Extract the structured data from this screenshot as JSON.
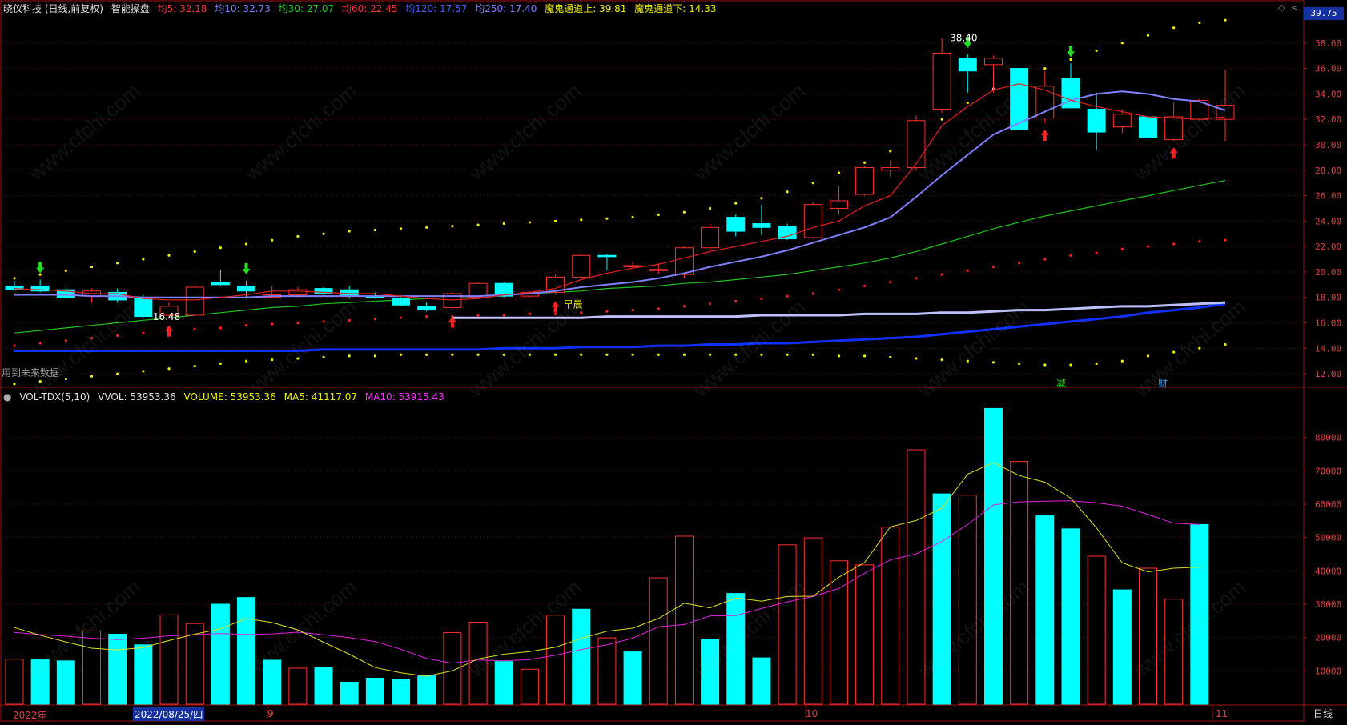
{
  "header": {
    "stock_title": "晓仪科技 (日线,前复权)",
    "indicator_name": "智能操盘",
    "ma5": "均5: 32.18",
    "ma10": "均10: 32.73",
    "ma30": "均30: 27.07",
    "ma60": "均60: 22.45",
    "ma120": "均120: 17.57",
    "ma250": "均250: 17.40",
    "channel_up": "魔鬼通道上: 39.81",
    "channel_down": "魔鬼通道下: 14.33",
    "price_badge": "39.75"
  },
  "volume_header": {
    "name": "VOL-TDX(5,10)",
    "vvol": "VVOL: 53953.36",
    "volume": "VOLUME: 53953.36",
    "ma5": "MA5: 41117.07",
    "ma10": "MA10: 53915.43"
  },
  "footer": {
    "year_label": "2022年",
    "cursor_date": "2022/08/25/四",
    "month_9": "9",
    "month_10": "10",
    "month_11": "11",
    "period_button": "日线"
  },
  "notes": {
    "future_data": "用到未来数据",
    "morning_star": "早晨",
    "high_label": "38.40",
    "low_label": "16.48",
    "flag_reduce": "减",
    "flag_finance": "财"
  },
  "watermark": "www.cfchi.com",
  "colors": {
    "up": "#ff3030",
    "down": "#00ffff",
    "ma5": "#e02020",
    "ma10": "#8080ff",
    "ma30": "#20c020",
    "ma120": "#c0c0ff",
    "ma250": "#1030ff",
    "vol_ma5": "#e0e020",
    "vol_ma10": "#e020e0",
    "axis": "#a01010"
  },
  "chart_data": [
    {
      "type": "candlestick",
      "title": "晓仪科技 (日线,前复权)",
      "ylim": [
        11,
        40
      ],
      "yticks": [
        "12.00",
        "14.00",
        "16.00",
        "18.00",
        "20.00",
        "22.00",
        "24.00",
        "26.00",
        "28.00",
        "30.00",
        "32.00",
        "34.00",
        "36.00",
        "38.00"
      ],
      "candles": [
        {
          "o": 18.9,
          "h": 19.3,
          "l": 18.5,
          "c": 18.6
        },
        {
          "o": 18.9,
          "h": 19.4,
          "l": 18.4,
          "c": 18.5
        },
        {
          "o": 18.6,
          "h": 18.8,
          "l": 17.9,
          "c": 18.0
        },
        {
          "o": 18.1,
          "h": 18.7,
          "l": 17.6,
          "c": 18.5
        },
        {
          "o": 18.4,
          "h": 18.7,
          "l": 17.6,
          "c": 17.8
        },
        {
          "o": 18.0,
          "h": 18.2,
          "l": 16.4,
          "c": 16.5
        },
        {
          "o": 16.6,
          "h": 17.6,
          "l": 16.3,
          "c": 17.3
        },
        {
          "o": 16.6,
          "h": 19.0,
          "l": 16.6,
          "c": 18.8
        },
        {
          "o": 19.2,
          "h": 20.2,
          "l": 18.9,
          "c": 19.0
        },
        {
          "o": 18.9,
          "h": 19.3,
          "l": 17.9,
          "c": 18.5
        },
        {
          "o": 18.0,
          "h": 18.9,
          "l": 17.9,
          "c": 18.2
        },
        {
          "o": 18.2,
          "h": 18.8,
          "l": 18.0,
          "c": 18.6
        },
        {
          "o": 18.7,
          "h": 18.8,
          "l": 18.1,
          "c": 18.3
        },
        {
          "o": 18.6,
          "h": 18.9,
          "l": 17.9,
          "c": 18.1
        },
        {
          "o": 18.1,
          "h": 18.4,
          "l": 17.9,
          "c": 18.0
        },
        {
          "o": 17.9,
          "h": 18.0,
          "l": 17.3,
          "c": 17.4
        },
        {
          "o": 17.3,
          "h": 17.6,
          "l": 16.9,
          "c": 17.0
        },
        {
          "o": 17.2,
          "h": 18.4,
          "l": 17.0,
          "c": 18.3
        },
        {
          "o": 18.0,
          "h": 19.2,
          "l": 17.9,
          "c": 19.1
        },
        {
          "o": 19.1,
          "h": 19.2,
          "l": 18.0,
          "c": 18.1
        },
        {
          "o": 18.1,
          "h": 18.5,
          "l": 18.0,
          "c": 18.4
        },
        {
          "o": 18.4,
          "h": 19.8,
          "l": 18.2,
          "c": 19.6
        },
        {
          "o": 19.6,
          "h": 21.5,
          "l": 19.5,
          "c": 21.3
        },
        {
          "o": 21.3,
          "h": 21.4,
          "l": 20.1,
          "c": 21.2
        },
        {
          "o": 20.4,
          "h": 20.8,
          "l": 20.3,
          "c": 20.5
        },
        {
          "o": 20.2,
          "h": 20.7,
          "l": 19.8,
          "c": 20.2
        },
        {
          "o": 19.8,
          "h": 22.0,
          "l": 19.5,
          "c": 21.9
        },
        {
          "o": 21.9,
          "h": 23.8,
          "l": 21.6,
          "c": 23.5
        },
        {
          "o": 24.3,
          "h": 24.5,
          "l": 22.8,
          "c": 23.2
        },
        {
          "o": 23.8,
          "h": 25.3,
          "l": 22.9,
          "c": 23.5
        },
        {
          "o": 23.6,
          "h": 23.8,
          "l": 22.5,
          "c": 22.6
        },
        {
          "o": 22.7,
          "h": 25.5,
          "l": 22.6,
          "c": 25.3
        },
        {
          "o": 25.0,
          "h": 26.8,
          "l": 24.5,
          "c": 25.6
        },
        {
          "o": 26.1,
          "h": 28.3,
          "l": 26.0,
          "c": 28.2
        },
        {
          "o": 28.0,
          "h": 28.8,
          "l": 27.5,
          "c": 28.2
        },
        {
          "o": 28.2,
          "h": 32.3,
          "l": 28.0,
          "c": 31.9
        },
        {
          "o": 32.8,
          "h": 38.4,
          "l": 32.5,
          "c": 37.2
        },
        {
          "o": 36.8,
          "h": 37.1,
          "l": 34.1,
          "c": 35.8
        },
        {
          "o": 36.3,
          "h": 37.0,
          "l": 34.1,
          "c": 36.8
        },
        {
          "o": 36.0,
          "h": 36.0,
          "l": 31.2,
          "c": 31.2
        },
        {
          "o": 32.1,
          "h": 35.8,
          "l": 31.7,
          "c": 34.6
        },
        {
          "o": 35.2,
          "h": 36.4,
          "l": 32.9,
          "c": 32.9
        },
        {
          "o": 32.8,
          "h": 34.1,
          "l": 29.6,
          "c": 31.0
        },
        {
          "o": 31.4,
          "h": 32.8,
          "l": 30.9,
          "c": 32.4
        },
        {
          "o": 32.2,
          "h": 32.6,
          "l": 30.4,
          "c": 30.6
        },
        {
          "o": 30.4,
          "h": 33.3,
          "l": 30.3,
          "c": 32.2
        },
        {
          "o": 32.0,
          "h": 33.6,
          "l": 31.9,
          "c": 33.5
        },
        {
          "o": 32.0,
          "h": 35.9,
          "l": 30.3,
          "c": 33.1
        }
      ],
      "ma5": [
        18.7,
        18.6,
        18.5,
        18.3,
        18.3,
        17.9,
        17.8,
        17.8,
        18.0,
        18.2,
        18.5,
        18.5,
        18.4,
        18.3,
        18.3,
        18.1,
        17.9,
        17.8,
        17.9,
        18.2,
        18.4,
        18.7,
        19.4,
        19.9,
        20.3,
        20.6,
        21.1,
        21.6,
        22.0,
        22.4,
        22.8,
        23.5,
        24.0,
        25.2,
        26.0,
        28.5,
        31.5,
        33.0,
        34.3,
        34.8,
        34.3,
        33.5,
        33.0,
        32.6,
        32.2,
        32.1,
        32.0,
        32.2
      ],
      "ma10": [
        18.2,
        18.2,
        18.2,
        18.1,
        18.1,
        18.0,
        18.0,
        18.0,
        18.0,
        18.0,
        18.1,
        18.1,
        18.1,
        18.1,
        18.1,
        18.1,
        18.1,
        18.1,
        18.1,
        18.2,
        18.3,
        18.5,
        18.8,
        19.0,
        19.2,
        19.5,
        19.9,
        20.4,
        20.8,
        21.2,
        21.7,
        22.3,
        22.9,
        23.5,
        24.3,
        25.9,
        27.6,
        29.2,
        30.8,
        31.7,
        32.6,
        33.5,
        34.0,
        34.2,
        34.0,
        33.6,
        33.4,
        32.7
      ],
      "ma30": [
        15.2,
        15.4,
        15.6,
        15.8,
        16.0,
        16.2,
        16.4,
        16.6,
        16.8,
        17.0,
        17.2,
        17.3,
        17.5,
        17.6,
        17.7,
        17.8,
        17.9,
        18.0,
        18.1,
        18.2,
        18.3,
        18.4,
        18.5,
        18.7,
        18.8,
        18.9,
        19.1,
        19.2,
        19.4,
        19.6,
        19.8,
        20.1,
        20.4,
        20.7,
        21.1,
        21.6,
        22.2,
        22.8,
        23.4,
        23.9,
        24.4,
        24.8,
        25.2,
        25.6,
        26.0,
        26.4,
        26.8,
        27.2
      ],
      "ma120": [
        null,
        null,
        null,
        null,
        null,
        null,
        null,
        null,
        null,
        null,
        null,
        null,
        null,
        null,
        null,
        null,
        null,
        16.4,
        16.4,
        16.4,
        16.4,
        16.4,
        16.4,
        16.5,
        16.5,
        16.5,
        16.5,
        16.5,
        16.5,
        16.6,
        16.6,
        16.6,
        16.6,
        16.7,
        16.7,
        16.7,
        16.8,
        16.8,
        16.9,
        17.0,
        17.0,
        17.1,
        17.2,
        17.3,
        17.3,
        17.4,
        17.5,
        17.6
      ],
      "ma250": [
        13.8,
        13.8,
        13.8,
        13.8,
        13.8,
        13.8,
        13.8,
        13.8,
        13.8,
        13.8,
        13.8,
        13.8,
        13.9,
        13.9,
        13.9,
        13.9,
        13.9,
        13.9,
        13.9,
        14.0,
        14.0,
        14.0,
        14.1,
        14.1,
        14.1,
        14.2,
        14.2,
        14.3,
        14.3,
        14.4,
        14.4,
        14.5,
        14.6,
        14.7,
        14.8,
        14.9,
        15.1,
        15.3,
        15.5,
        15.7,
        15.9,
        16.1,
        16.3,
        16.5,
        16.8,
        17.0,
        17.2,
        17.5
      ],
      "upper_channel": [
        19.5,
        19.8,
        20.1,
        20.4,
        20.7,
        21.0,
        21.3,
        21.6,
        21.9,
        22.2,
        22.5,
        22.8,
        23.0,
        23.2,
        23.3,
        23.4,
        23.5,
        23.6,
        23.7,
        23.8,
        23.9,
        24.0,
        24.1,
        24.2,
        24.3,
        24.5,
        24.7,
        25.0,
        25.4,
        25.8,
        26.3,
        27.0,
        27.8,
        28.6,
        29.5,
        30.7,
        32.0,
        33.3,
        34.4,
        35.2,
        36.0,
        36.7,
        37.4,
        38.0,
        38.6,
        39.2,
        39.6,
        39.8
      ],
      "lower_channel": [
        11.2,
        11.4,
        11.6,
        11.8,
        12.0,
        12.2,
        12.4,
        12.6,
        12.8,
        13.0,
        13.1,
        13.2,
        13.3,
        13.4,
        13.4,
        13.5,
        13.5,
        13.5,
        13.5,
        13.5,
        13.5,
        13.5,
        13.5,
        13.5,
        13.5,
        13.5,
        13.5,
        13.5,
        13.5,
        13.5,
        13.5,
        13.5,
        13.4,
        13.4,
        13.3,
        13.2,
        13.1,
        13.0,
        12.9,
        12.8,
        12.7,
        12.7,
        12.8,
        13.0,
        13.4,
        13.7,
        14.0,
        14.3
      ],
      "mid_dots": [
        14.2,
        14.4,
        14.6,
        14.8,
        15.0,
        15.2,
        15.3,
        15.5,
        15.6,
        15.8,
        15.9,
        16.0,
        16.1,
        16.2,
        16.3,
        16.4,
        16.5,
        16.5,
        16.6,
        16.6,
        16.7,
        16.7,
        16.8,
        16.9,
        17.0,
        17.1,
        17.3,
        17.5,
        17.7,
        17.9,
        18.1,
        18.3,
        18.6,
        18.9,
        19.2,
        19.5,
        19.8,
        20.1,
        20.4,
        20.7,
        21.0,
        21.3,
        21.5,
        21.8,
        22.0,
        22.2,
        22.4,
        22.5
      ],
      "buy_arrows": [
        6,
        17,
        21,
        40,
        45
      ],
      "sell_arrows": [
        1,
        9,
        37,
        41
      ],
      "annotations": {
        "high": {
          "index": 36,
          "value": 38.4
        },
        "low": {
          "index": 5,
          "value": 16.48
        }
      }
    },
    {
      "type": "bar",
      "title": "VOL-TDX(5,10)",
      "ylim": [
        0,
        90000
      ],
      "yticks": [
        "10000",
        "20000",
        "30000",
        "40000",
        "50000",
        "60000",
        "70000",
        "80000"
      ],
      "volumes": [
        13500,
        13300,
        13000,
        22000,
        21000,
        17800,
        26800,
        24200,
        30000,
        32000,
        13200,
        10800,
        11000,
        6600,
        7800,
        7400,
        8500,
        21500,
        24600,
        12800,
        10500,
        26700,
        28500,
        19900,
        15700,
        37900,
        50400,
        19400,
        33200,
        13900,
        47800,
        49900,
        43000,
        41800,
        53100,
        76300,
        63100,
        62700,
        88700,
        72800,
        56500,
        52600,
        44400,
        34300,
        40800,
        31500,
        53900
      ],
      "vol_ma5": [
        23000,
        20700,
        18700,
        16800,
        16300,
        17000,
        19100,
        21000,
        22600,
        25700,
        24500,
        22300,
        18600,
        15000,
        11000,
        9400,
        8400,
        10000,
        13600,
        15000,
        15800,
        17100,
        19700,
        21900,
        22800,
        25700,
        30300,
        28900,
        31900,
        30900,
        32300,
        32400,
        38100,
        42500,
        53200,
        55100,
        58800,
        69000,
        72500,
        68600,
        66600,
        61800,
        52900,
        42400,
        39700,
        40800,
        41100
      ],
      "vol_ma10": [
        21500,
        20900,
        20400,
        19800,
        19400,
        19800,
        20500,
        20900,
        21200,
        20900,
        21100,
        21600,
        20800,
        20000,
        18800,
        16500,
        13700,
        12300,
        13300,
        13000,
        13400,
        14700,
        16400,
        17800,
        19800,
        23200,
        23900,
        26500,
        26600,
        28700,
        30700,
        32300,
        34700,
        39300,
        43300,
        45100,
        48800,
        53900,
        59800,
        60700,
        60900,
        61000,
        60400,
        59400,
        56900,
        54300,
        53900
      ],
      "up_flags": [
        true,
        false,
        false,
        true,
        false,
        false,
        true,
        true,
        false,
        false,
        false,
        true,
        false,
        false,
        false,
        false,
        false,
        true,
        true,
        false,
        true,
        true,
        false,
        true,
        false,
        true,
        true,
        false,
        false,
        false,
        true,
        true,
        true,
        true,
        true,
        true,
        false,
        true,
        false,
        true,
        false,
        false,
        true,
        false,
        true,
        true,
        false
      ]
    }
  ]
}
